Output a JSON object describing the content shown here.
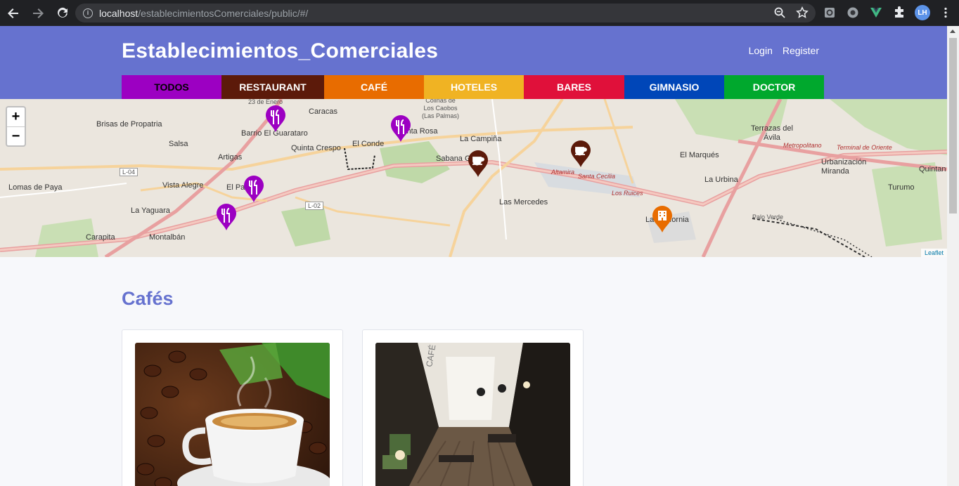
{
  "browser": {
    "url_host": "localhost",
    "url_path": "/establecimientosComerciales/public/#/",
    "profile_initials": "LH"
  },
  "header": {
    "brand": "Establecimientos_Comerciales",
    "login": "Login",
    "register": "Register"
  },
  "categories": [
    {
      "label": "TODOS",
      "color": "#9c00c2",
      "text_color": "#000000"
    },
    {
      "label": "RESTAURANT",
      "color": "#5c1a0a",
      "text_color": "#ffffff"
    },
    {
      "label": "CAFÉ",
      "color": "#e86c00",
      "text_color": "#ffffff"
    },
    {
      "label": "HOTELES",
      "color": "#f0b323",
      "text_color": "#ffffff"
    },
    {
      "label": "BARES",
      "color": "#e0103a",
      "text_color": "#ffffff"
    },
    {
      "label": "GIMNASIO",
      "color": "#0046b8",
      "text_color": "#ffffff"
    },
    {
      "label": "DOCTOR",
      "color": "#00a82d",
      "text_color": "#ffffff"
    }
  ],
  "map": {
    "zoom_in": "+",
    "zoom_out": "−",
    "attribution": "Leaflet",
    "labels": {
      "enero": "23 de Enero",
      "caracas": "Caracas",
      "los_caobos": "Colinas de\nLos Caobos\n(Las Palmas)",
      "brisas": "Brisas de Propatria",
      "guarataro": "Barrio El Guarataro",
      "salsa": "Salsa",
      "artigas": "Artigas",
      "quinta": "Quinta Crespo",
      "el_conde": "El Conde",
      "santa_rosa": "Santa Rosa",
      "la_campina": "La Campiña",
      "sabana": "Sabana G",
      "lomas": "Lomas de Paya",
      "vista": "Vista Alegre",
      "el_pa": "El Pa",
      "la_yaguara": "La Yaguara",
      "carapita": "Carapita",
      "montalban": "Montalbán",
      "las_mercedes": "Las Mercedes",
      "el_marques": "El Marqués",
      "la_urbina": "La Urbina",
      "terrazas": "Terrazas del\nÁvila",
      "urbanizacion": "Urbanización\nMiranda",
      "turumo": "Turumo",
      "quintan": "Quintan",
      "la_california": "La California",
      "palo_verde": "Palo Verde",
      "altamira": "Altamira",
      "santa_cecilia": "Santa Cecilia",
      "los_ruices": "Los Ruices",
      "l04": "L-04",
      "l02": "L-02",
      "metropolitano": "Metropolitano",
      "terminal": "Terminal de Oriente"
    }
  },
  "content": {
    "section_title": "Cafés"
  }
}
